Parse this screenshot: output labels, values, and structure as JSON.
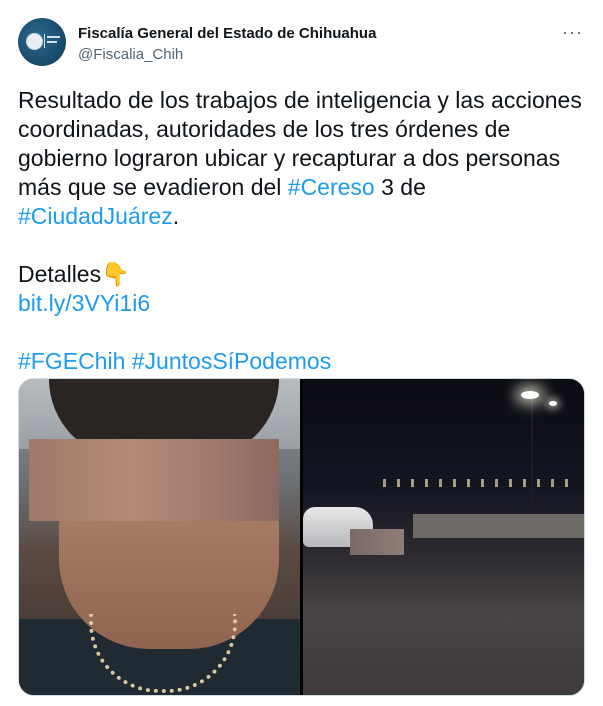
{
  "tweet": {
    "author": {
      "display_name": "Fiscalía General del Estado de Chihuahua",
      "handle": "@Fiscalia_Chih",
      "avatar_icon": "fiscalia-logo-avatar"
    },
    "more_label": "···",
    "text_lines": [
      [
        {
          "t": "Resultado de los trabajos de inteligencia y las acciones"
        }
      ],
      [
        {
          "t": "coordinadas, autoridades de los tres órdenes de"
        }
      ],
      [
        {
          "t": "gobierno lograron ubicar y recapturar a dos personas"
        }
      ],
      [
        {
          "t": "más que se evadieron del "
        },
        {
          "t": "#Cereso",
          "link": true
        },
        {
          "t": " 3 de"
        }
      ],
      [
        {
          "t": "#CiudadJuárez",
          "link": true
        },
        {
          "t": "."
        }
      ],
      [],
      [
        {
          "t": "Detalles👇"
        }
      ],
      [
        {
          "t": "bit.ly/3VYi1i6",
          "link": true
        }
      ],
      [],
      [
        {
          "t": "#FGEChih",
          "link": true
        },
        {
          "t": " "
        },
        {
          "t": "#JuntosSíPodemos",
          "link": true
        }
      ]
    ],
    "media": [
      {
        "description_icon": "photo-person-censored"
      },
      {
        "description_icon": "photo-night-scene"
      }
    ],
    "colors": {
      "link": "#1d9bf0",
      "text": "#0f1419",
      "secondary": "#536471"
    }
  }
}
